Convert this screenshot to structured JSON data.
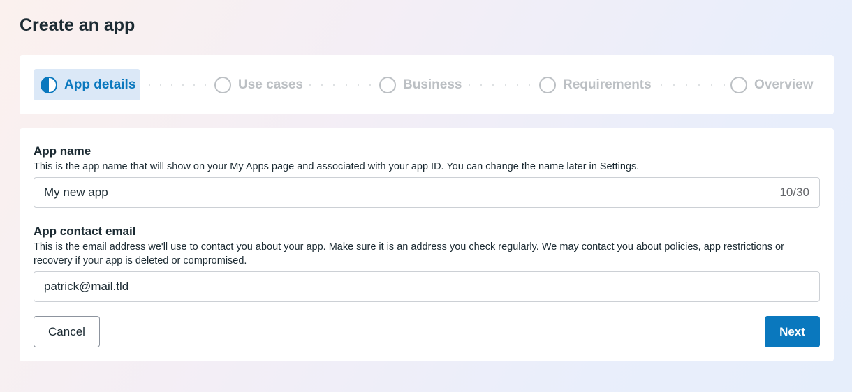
{
  "page": {
    "title": "Create an app"
  },
  "steps": [
    {
      "label": "App details",
      "state": "active"
    },
    {
      "label": "Use cases",
      "state": "inactive"
    },
    {
      "label": "Business",
      "state": "inactive"
    },
    {
      "label": "Requirements",
      "state": "inactive"
    },
    {
      "label": "Overview",
      "state": "inactive"
    }
  ],
  "form": {
    "app_name": {
      "label": "App name",
      "description": "This is the app name that will show on your My Apps page and associated with your app ID. You can change the name later in Settings.",
      "value": "My new app",
      "counter": "10/30"
    },
    "contact_email": {
      "label": "App contact email",
      "description": "This is the email address we'll use to contact you about your app. Make sure it is an address you check regularly. We may contact you about policies, app restrictions or recovery if your app is deleted or compromised.",
      "value": "patrick@mail.tld"
    }
  },
  "actions": {
    "cancel_label": "Cancel",
    "next_label": "Next"
  },
  "colors": {
    "accent": "#0a78be",
    "active_step_bg": "#dbe8f7",
    "inactive": "#bcc0c4"
  }
}
